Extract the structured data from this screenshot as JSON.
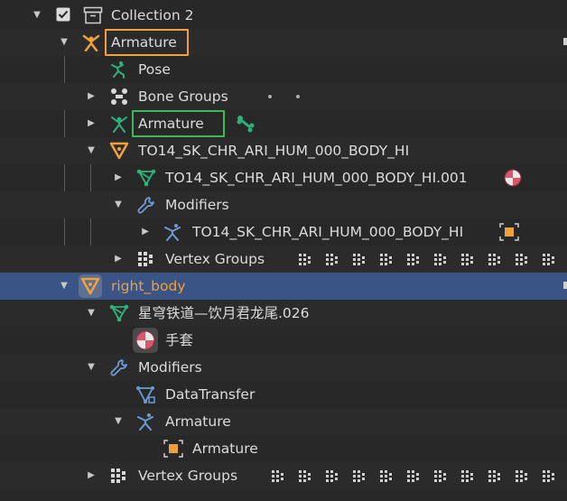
{
  "colors": {
    "background": "#282828",
    "row_alt": "#2b2b2b",
    "selected_row": "#3a5486",
    "orange_highlight": "#f0a03c",
    "green_highlight": "#3cba5a",
    "bone_green": "#2fb27a"
  },
  "outliner": {
    "collection": {
      "label": "Collection 2",
      "checked": true
    },
    "armature_object": {
      "label": "Armature"
    },
    "pose": {
      "label": "Pose"
    },
    "bone_groups": {
      "label": "Bone Groups"
    },
    "armature_data": {
      "label": "Armature"
    },
    "mesh_object": {
      "label": "TO14_SK_CHR_ARI_HUM_000_BODY_HI"
    },
    "mesh_data": {
      "label": "TO14_SK_CHR_ARI_HUM_000_BODY_HI.001"
    },
    "modifiers_1": {
      "label": "Modifiers"
    },
    "armature_modifier": {
      "label": "TO14_SK_CHR_ARI_HUM_000_BODY_HI"
    },
    "vertex_groups_1": {
      "label": "Vertex Groups"
    },
    "right_body": {
      "label": "right_body"
    },
    "mesh_data_2": {
      "label": "星穹铁道—饮月君龙尾.026"
    },
    "material": {
      "label": "手套"
    },
    "modifiers_2": {
      "label": "Modifiers"
    },
    "datatransfer": {
      "label": "DataTransfer"
    },
    "armature_modifier_2": {
      "label": "Armature"
    },
    "armature_target": {
      "label": "Armature"
    },
    "vertex_groups_2": {
      "label": "Vertex Groups"
    }
  },
  "icons": {
    "expand": "triangle-right-icon",
    "collapse": "triangle-down-icon",
    "checkbox": "checkbox-checked-icon",
    "collection": "collection-icon",
    "armature": "armature-icon",
    "pose": "pose-icon",
    "bone_groups": "bone-groups-icon",
    "bone": "bone-icon",
    "mesh": "mesh-triangle-icon",
    "mesh_data": "mesh-data-icon",
    "modifier": "wrench-icon",
    "material": "material-sphere-icon",
    "vertex_group": "vertex-group-icon",
    "datatransfer": "datatransfer-icon"
  }
}
